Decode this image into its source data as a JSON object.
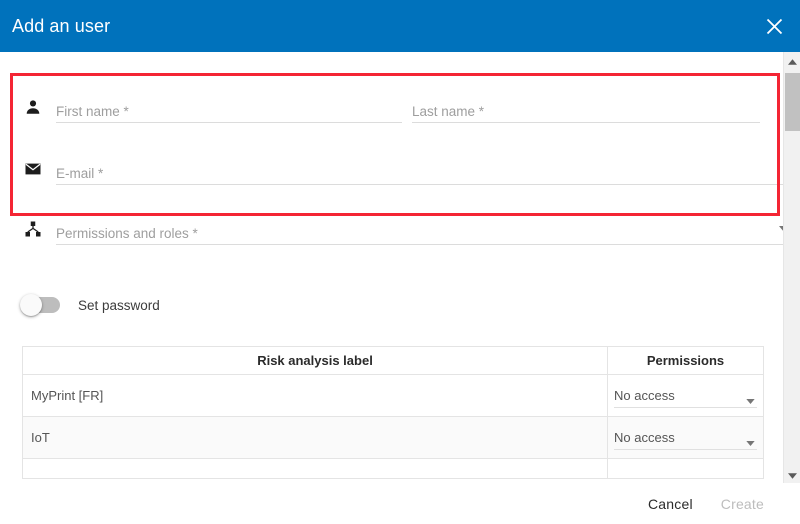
{
  "titlebar": {
    "title": "Add an user",
    "close_icon": "close-icon"
  },
  "form": {
    "first_name": {
      "icon": "person-icon",
      "placeholder": "First name *",
      "value": ""
    },
    "last_name": {
      "placeholder": "Last name *",
      "value": ""
    },
    "email": {
      "icon": "mail-icon",
      "placeholder": "E-mail *",
      "value": ""
    },
    "permissions_and_roles": {
      "icon": "account-tree-icon",
      "placeholder": "Permissions and roles *",
      "value": "",
      "caret_icon": "chevron-down-icon"
    },
    "set_password": {
      "label": "Set password",
      "state": "off"
    }
  },
  "table": {
    "headers": [
      "Risk analysis label",
      "Permissions"
    ],
    "rows": [
      {
        "label": "MyPrint [FR]",
        "permission": "No access"
      },
      {
        "label": "IoT",
        "permission": "No access"
      }
    ]
  },
  "footer": {
    "cancel_label": "Cancel",
    "create_label": "Create"
  },
  "scrollbar": {
    "up_icon": "scroll-up-icon",
    "down_icon": "scroll-down-icon"
  },
  "colors": {
    "header_blue": "#0072bc",
    "highlight_red": "#f42534",
    "disabled_gray": "#bdbdbd"
  }
}
